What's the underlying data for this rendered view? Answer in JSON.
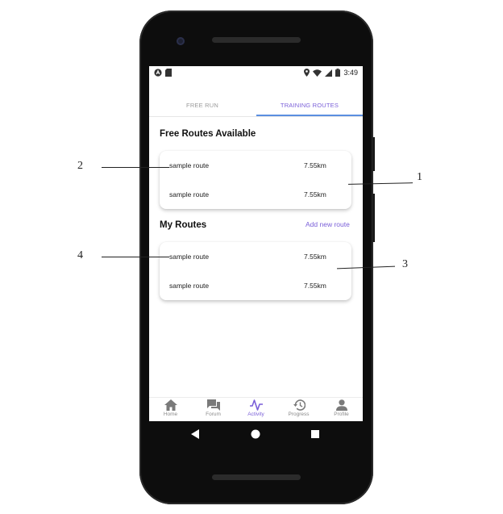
{
  "statusbar": {
    "time": "3:49"
  },
  "tabs": [
    {
      "label": "FREE RUN"
    },
    {
      "label": "TRAINING ROUTES"
    }
  ],
  "free_routes": {
    "title": "Free Routes Available",
    "items": [
      {
        "name": "sample route",
        "distance": "7.55km"
      },
      {
        "name": "sample route",
        "distance": "7.55km"
      }
    ]
  },
  "my_routes": {
    "title": "My Routes",
    "add_label": "Add new route",
    "items": [
      {
        "name": "sample route",
        "distance": "7.55km"
      },
      {
        "name": "sample route",
        "distance": "7.55km"
      }
    ]
  },
  "bottom_nav": [
    {
      "label": "Home",
      "icon": "home-icon"
    },
    {
      "label": "Forum",
      "icon": "forum-icon"
    },
    {
      "label": "Activity",
      "icon": "activity-icon",
      "active": true
    },
    {
      "label": "Progress",
      "icon": "progress-icon"
    },
    {
      "label": "Profile",
      "icon": "profile-icon"
    }
  ],
  "annotations": [
    "1",
    "2",
    "3",
    "4"
  ],
  "colors": {
    "accent": "#7a5fd8",
    "tab_indicator": "#5b8fe0"
  }
}
